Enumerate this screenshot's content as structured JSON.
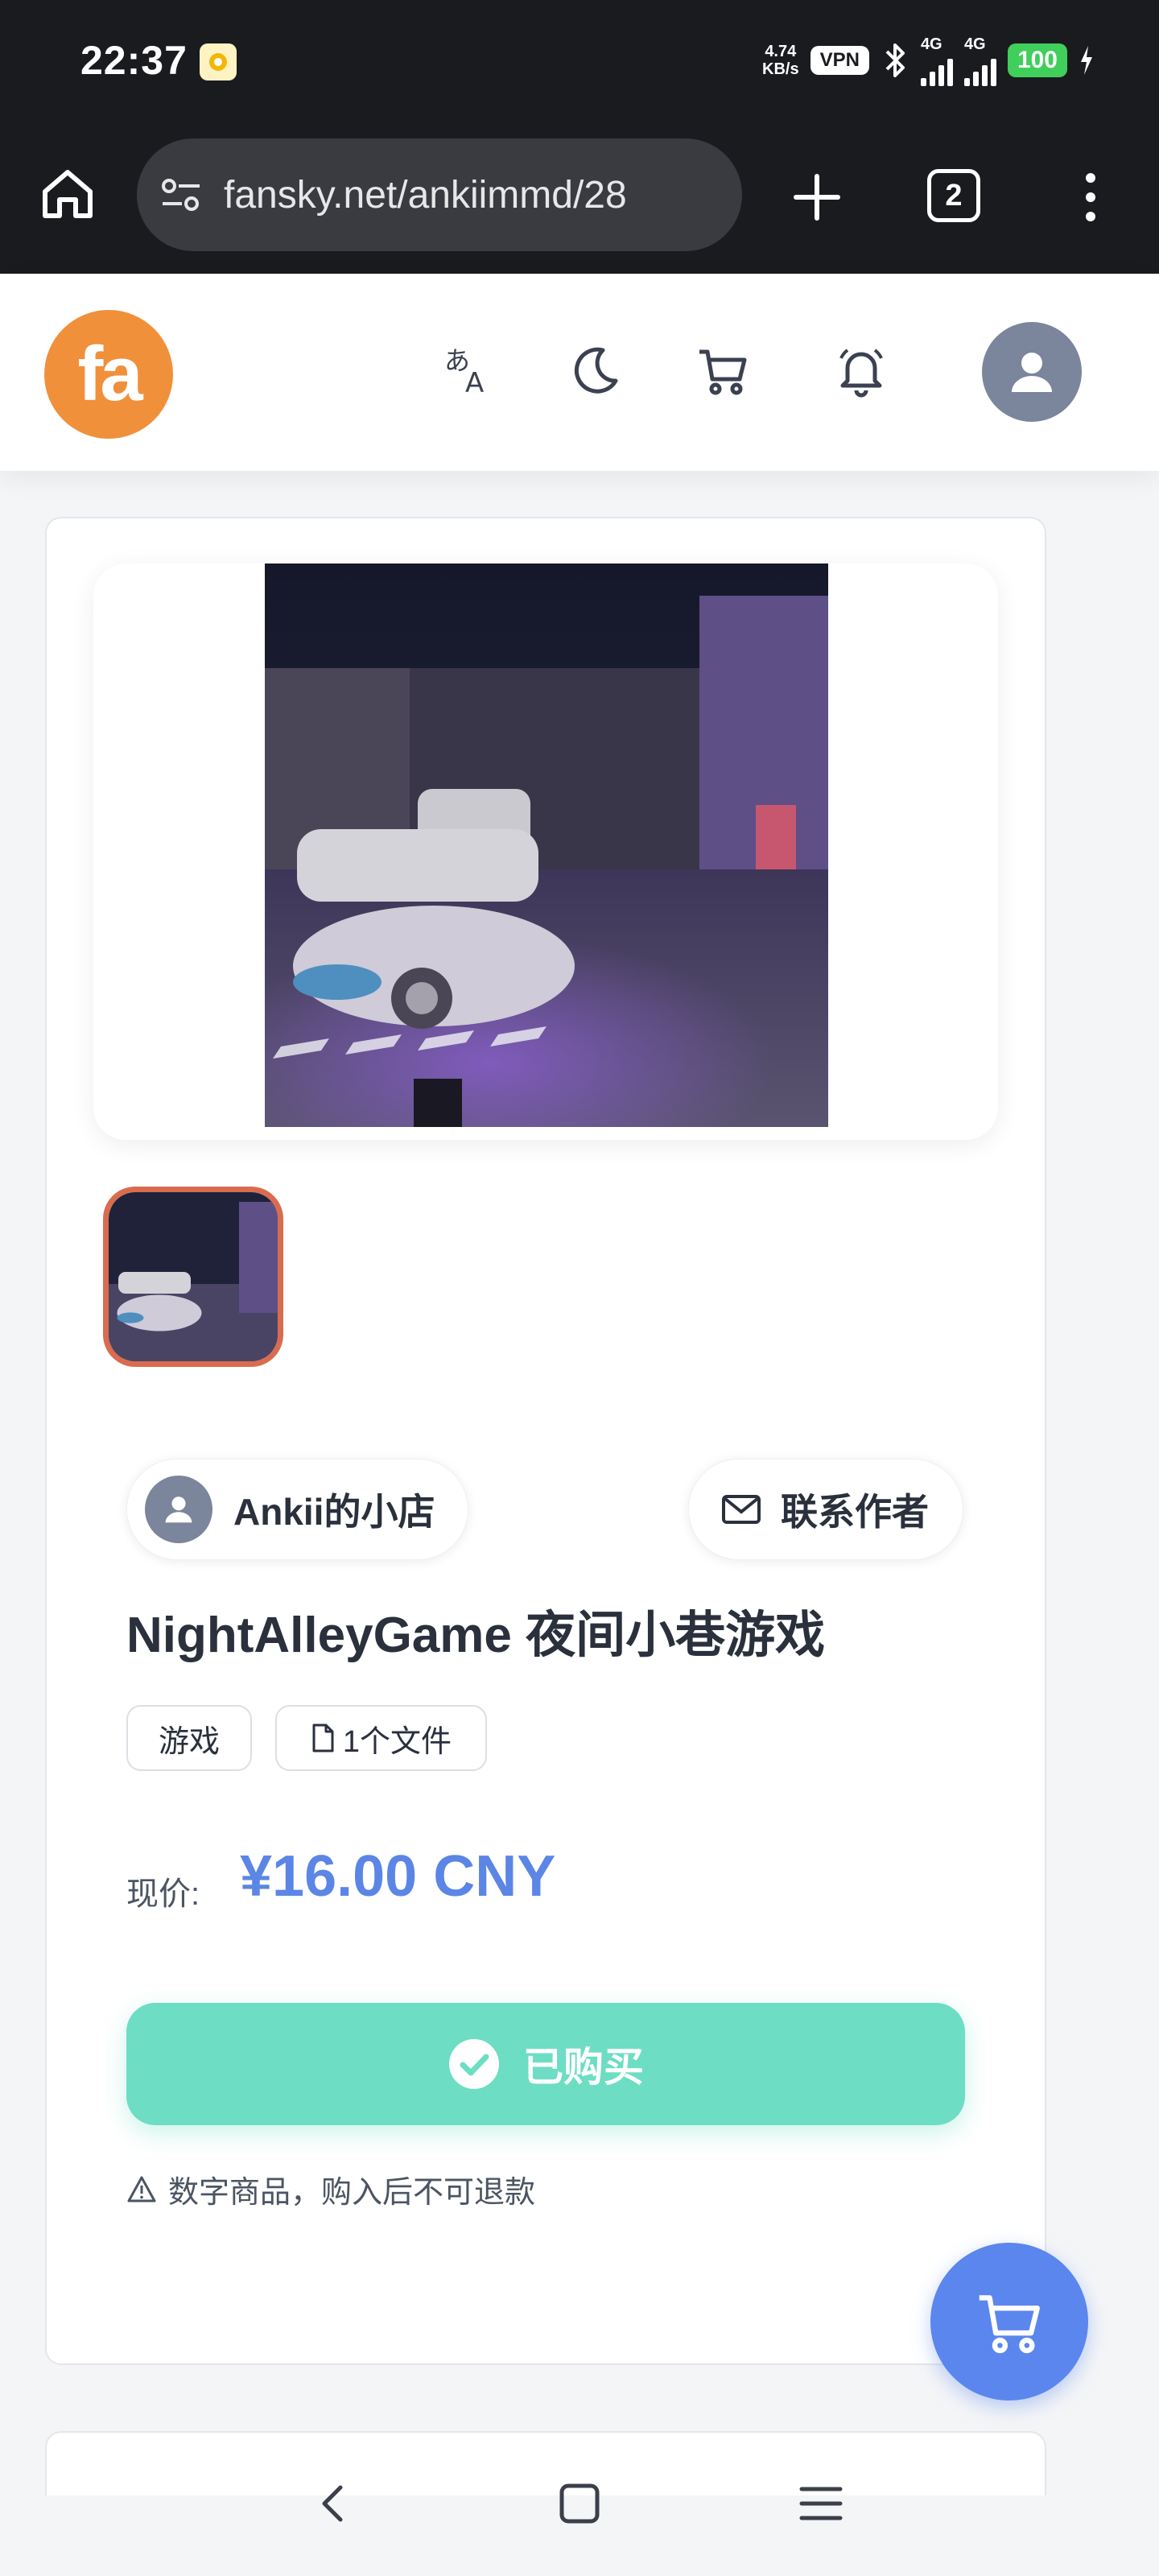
{
  "status_bar": {
    "time": "22:37",
    "net_speed_value": "4.74",
    "net_speed_unit": "KB/s",
    "vpn": "VPN",
    "net1": "4G",
    "net2": "4G",
    "battery": "100"
  },
  "browser": {
    "url": "fansky.net/ankiimmd/28",
    "tab_count": "2"
  },
  "header": {
    "logo_text": "fa",
    "icons": [
      "translate-icon",
      "moon-icon",
      "cart-icon",
      "bell-icon",
      "user-avatar-icon"
    ]
  },
  "product": {
    "shop_name": "Ankii的小店",
    "contact_label": "联系作者",
    "title": "NightAlleyGame 夜间小巷游戏",
    "tags": [
      "游戏",
      "1个文件"
    ],
    "price_label": "现价:",
    "price": "¥16.00 CNY",
    "purchased_label": "已购买",
    "notice": "数字商品，购入后不可退款"
  },
  "colors": {
    "accent": "#5b86e5",
    "logo": "#f0903a",
    "purchased": "#6dddc4",
    "thumb_border": "#d96c4f"
  }
}
